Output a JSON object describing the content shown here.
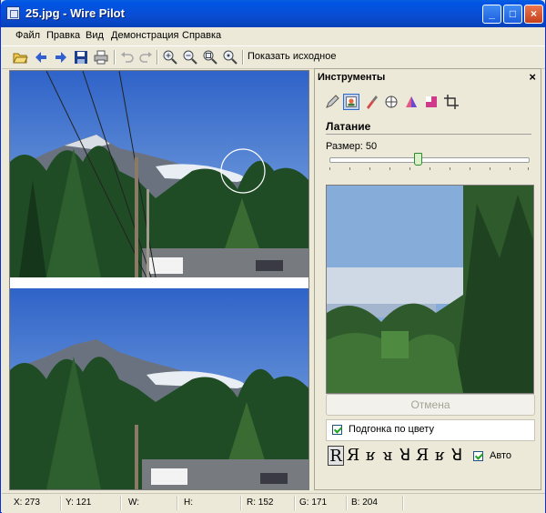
{
  "window": {
    "title": "25.jpg - Wire Pilot",
    "minimize": "_",
    "maximize": "□",
    "close": "×"
  },
  "menu": {
    "items": [
      "Файл",
      "Правка",
      "Вид",
      "Демонстрация",
      "Справка"
    ]
  },
  "toolbar": {
    "show_original": "Показать исходное",
    "icons": [
      "open-icon",
      "back-icon",
      "forward-icon",
      "save-icon",
      "print-icon",
      "undo-icon",
      "redo-icon",
      "zoom-in-icon",
      "zoom-out-icon",
      "zoom-fit-icon",
      "zoom-actual-icon"
    ]
  },
  "panel": {
    "title": "Инструменты",
    "close": "×",
    "section_title": "Латание",
    "size_label": "Размер: 50",
    "size_value": 50,
    "cancel": "Отмена",
    "color_match": "Подгонка по цвету",
    "auto": "Авто",
    "tool_icons": [
      "pencil-icon",
      "patch-icon",
      "brush-icon",
      "clone-icon",
      "color-icon",
      "mask-icon",
      "crop-icon"
    ],
    "glyphs": [
      "R",
      "Я",
      "ʁ",
      "ᴚ",
      "ꓤ",
      "Я",
      "ʁ",
      "ꓤ"
    ]
  },
  "status": {
    "x": "X: 273",
    "y": "Y: 121",
    "w": "W:",
    "h": "H:",
    "r": "R: 152",
    "g": "G: 171",
    "b": "B: 204"
  },
  "colors": {
    "title_blue": "#0055E5",
    "face": "#ECE9D8",
    "sky": "#7fa6d8"
  }
}
